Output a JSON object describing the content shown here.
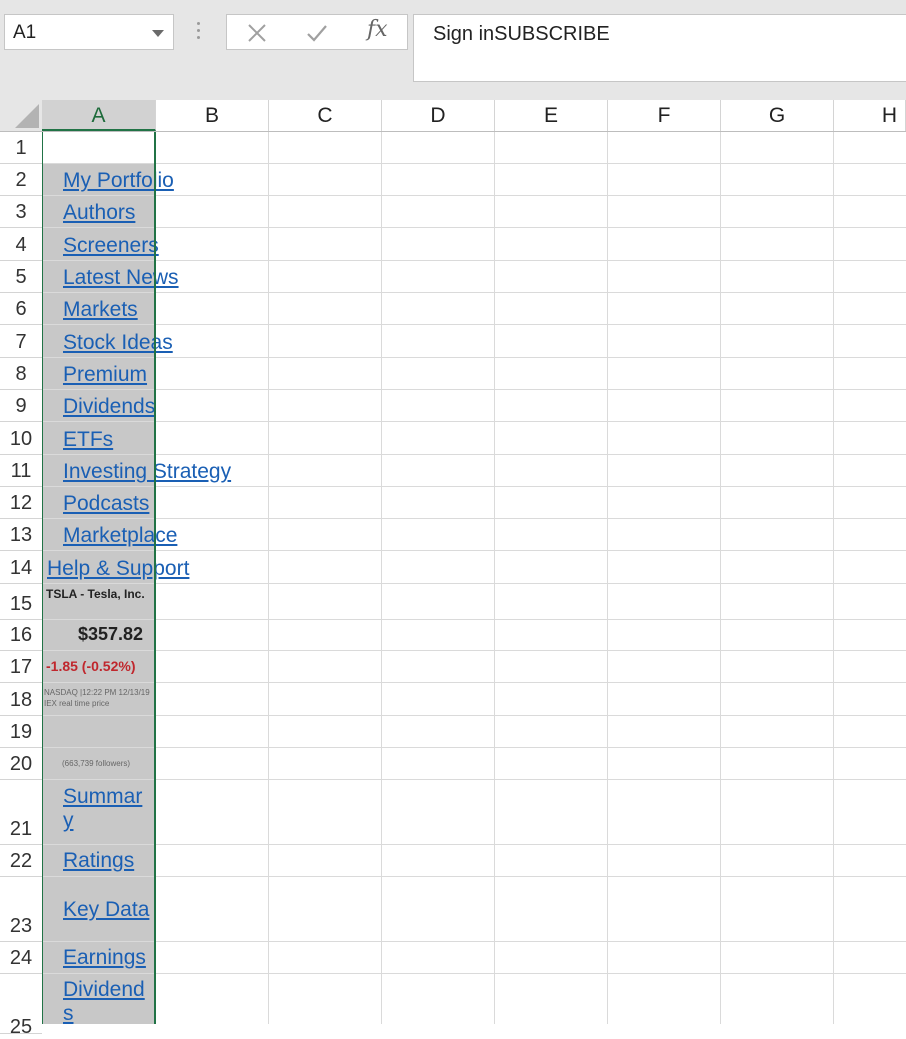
{
  "name_box": {
    "value": "A1"
  },
  "formula_bar": {
    "fx_label": "fx",
    "content": "Sign inSUBSCRIBE"
  },
  "columns": [
    "A",
    "B",
    "C",
    "D",
    "E",
    "F",
    "G",
    "H"
  ],
  "rows": [
    "1",
    "2",
    "3",
    "4",
    "5",
    "6",
    "7",
    "8",
    "9",
    "10",
    "11",
    "12",
    "13",
    "14",
    "15",
    "16",
    "17",
    "18",
    "19",
    "20",
    "21",
    "22",
    "23",
    "24",
    "25"
  ],
  "cells": {
    "a2": "My Portfolio",
    "a3": "Authors",
    "a4": "Screeners",
    "a5": "Latest News",
    "a6": "Markets",
    "a7": "Stock Ideas",
    "a8": "Premium",
    "a9": "Dividends",
    "a10": "ETFs",
    "a11": "Investing Strategy",
    "a12": "Podcasts",
    "a13": "Marketplace",
    "a14": "Help & Support",
    "a15": "TSLA - Tesla, Inc.",
    "a16": "$357.82",
    "a17": "-1.85 (-0.52%)",
    "a18": "NASDAQ |12:22 PM 12/13/19 IEX real time price",
    "a20": "(663,739 followers)",
    "a21_line1": "Summar",
    "a21_line2": "y",
    "a22": "Ratings",
    "a23": "Key Data",
    "a24": "Earnings",
    "a25_line1": "Dividend",
    "a25_line2": "s"
  },
  "colors": {
    "selection": "#217346",
    "link": "#1a5fb4",
    "negative_change": "#c0272d",
    "column_a_fill": "#c8c8c8"
  }
}
